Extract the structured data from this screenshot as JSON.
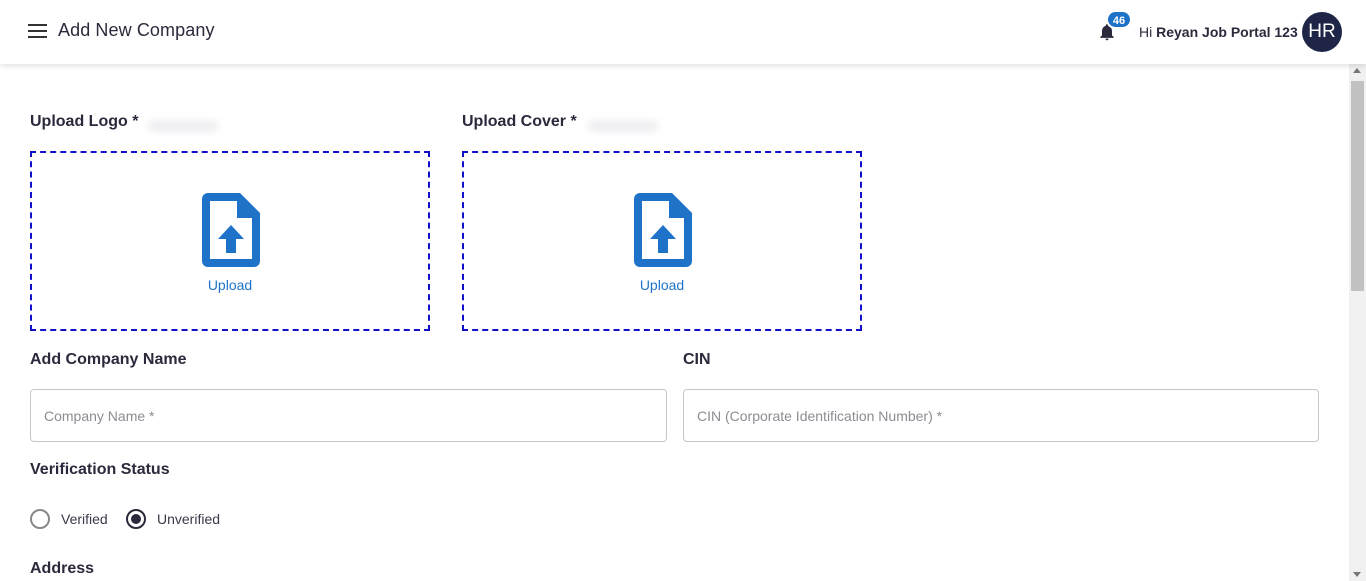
{
  "header": {
    "title": "Add New Company",
    "notification_count": "46",
    "greeting_prefix": "Hi",
    "user_name": "Reyan Job Portal 123",
    "avatar_initials": "HR"
  },
  "upload_logo": {
    "label": "Upload Logo *",
    "button_text": "Upload"
  },
  "upload_cover": {
    "label": "Upload Cover *",
    "button_text": "Upload"
  },
  "company_name": {
    "label": "Add Company Name",
    "value": "",
    "placeholder": "Company Name *"
  },
  "cin": {
    "label": "CIN",
    "value": "",
    "placeholder": "CIN (Corporate Identification Number) *"
  },
  "verification": {
    "label": "Verification Status",
    "options": [
      "Verified",
      "Unverified"
    ],
    "selected": "Unverified"
  },
  "address": {
    "label": "Address"
  },
  "colors": {
    "accent": "#1e73c9",
    "dropzone_border": "#1010c8",
    "avatar_bg": "#1f2546",
    "text": "#2a2a3c"
  },
  "icons": {
    "menu": "hamburger-menu-icon",
    "notification": "bell-icon",
    "upload": "file-upload-icon"
  }
}
